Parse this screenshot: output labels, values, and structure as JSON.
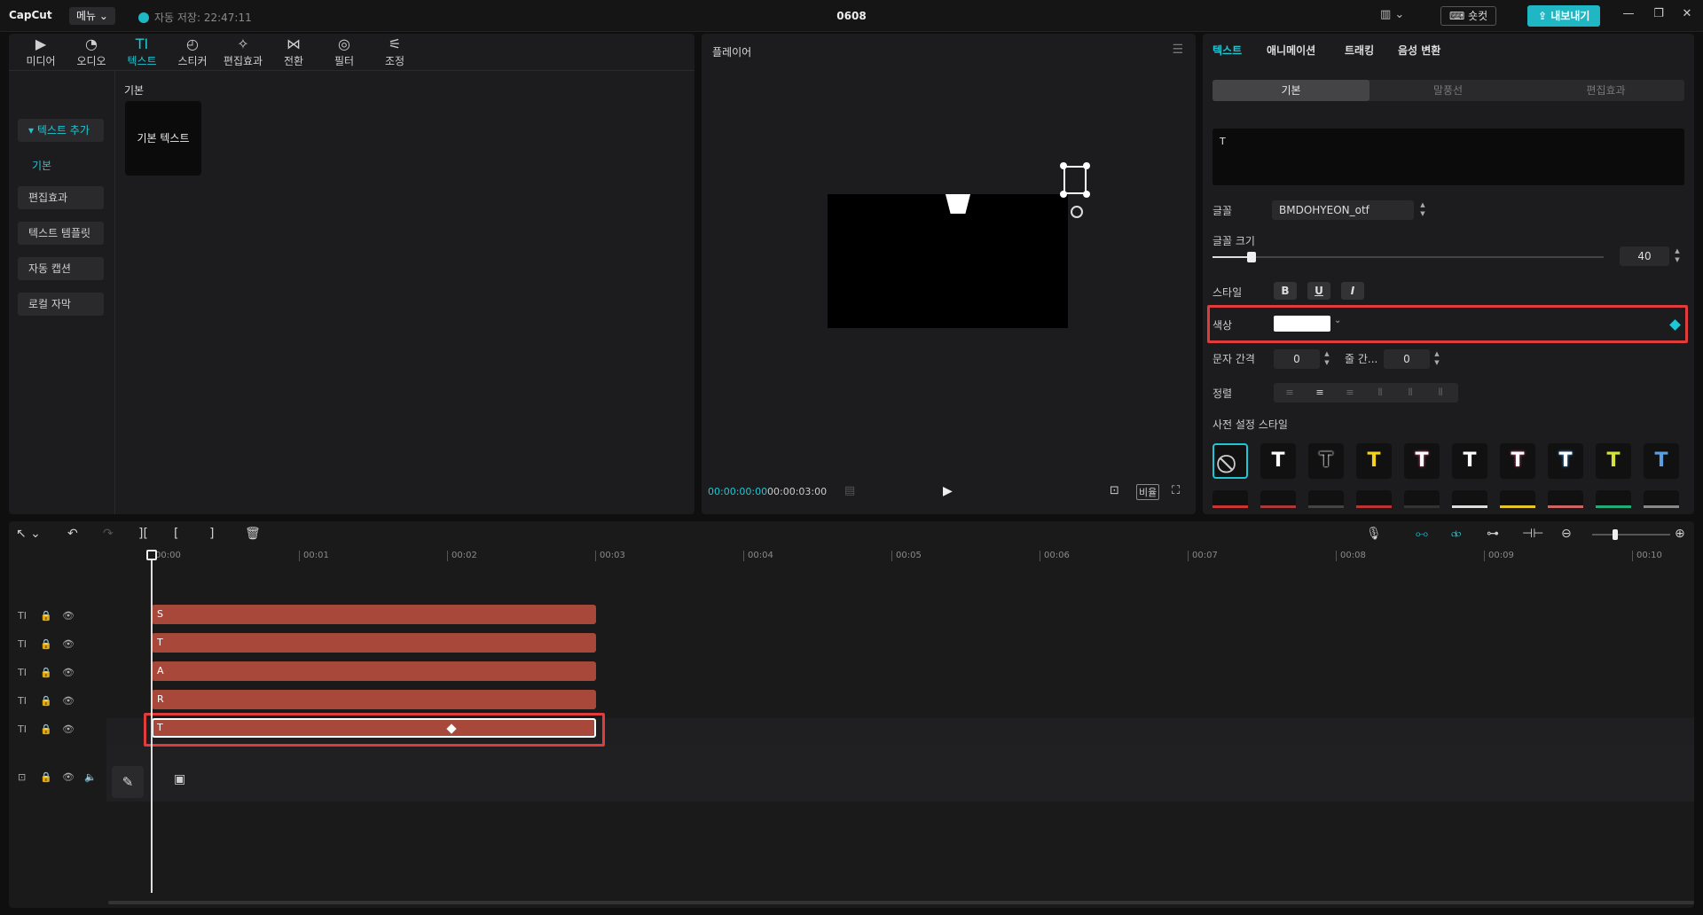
{
  "titlebar": {
    "logo": "CapCut",
    "menu_label": "메뉴 ⌄",
    "autosave": "자동 저장: 22:47:11",
    "title": "0608",
    "layout_icon": "▥ ⌄",
    "shortcut_label": "⌨ 숏컷",
    "export_label": "⇪ 내보내기",
    "minimize": "—",
    "maximize": "❐",
    "close": "✕"
  },
  "toolbar": {
    "tabs": [
      {
        "icon": "▶",
        "label": "미디어"
      },
      {
        "icon": "◔",
        "label": "오디오"
      },
      {
        "icon": "TI",
        "label": "텍스트"
      },
      {
        "icon": "◴",
        "label": "스티커"
      },
      {
        "icon": "✧",
        "label": "편집효과"
      },
      {
        "icon": "⋈",
        "label": "전환"
      },
      {
        "icon": "◎",
        "label": "필터"
      },
      {
        "icon": "⚟",
        "label": "조정"
      }
    ]
  },
  "left_nav": {
    "add_text": "▾ 텍스트 추가",
    "basic": "기본",
    "effects": "편집효과",
    "template": "텍스트 템플릿",
    "captions": "자동 캡션",
    "local_subtitle": "로컬 자막"
  },
  "library": {
    "section": "기본",
    "card_label": "기본 텍스트"
  },
  "player": {
    "title": "플레이어",
    "menu_icon": "☰",
    "time_current": "00:00:00:00",
    "time_total": "00:00:03:00",
    "timecode_icon": "▤",
    "play_icon": "▶",
    "zoom_fit_icon": "⊡",
    "ratio_label": "비율",
    "fullscreen_icon": "⛶"
  },
  "props": {
    "tabs": [
      "텍스트",
      "애니메이션",
      "트래킹",
      "음성 변환"
    ],
    "segments": [
      "기본",
      "말풍선",
      "편집효과"
    ],
    "text_value": "T",
    "font_label": "글꼴",
    "font_value": "BMDOHYEON_otf",
    "size_label": "글꼴 크기",
    "size_value": "40",
    "size_fraction": 0.1,
    "style_label": "스타일",
    "style_buttons": [
      "B",
      "U",
      "I"
    ],
    "color_label": "색상",
    "color_value": "#ffffff",
    "spacing_label": "문자 간격",
    "spacing_value": "0",
    "line_label": "줄 간...",
    "line_value": "0",
    "align_label": "정렬",
    "align_icons": [
      "≡",
      "≡",
      "≡",
      "⦀",
      "⦀",
      "⦀"
    ],
    "preset_label": "사전 설정 스타일",
    "presets": [
      {
        "glyph": "⃠",
        "color": "#cccccc"
      },
      {
        "glyph": "T",
        "color": "#ffffff"
      },
      {
        "glyph": "T",
        "color": "#111111"
      },
      {
        "glyph": "T",
        "color": "#f5d21b"
      },
      {
        "glyph": "T",
        "color": "#ffffff"
      },
      {
        "glyph": "T",
        "color": "#ffffff"
      },
      {
        "glyph": "T",
        "color": "#ffffff"
      },
      {
        "glyph": "T",
        "color": "#ffffff"
      },
      {
        "glyph": "T",
        "color": "#d4e23a"
      },
      {
        "glyph": "T",
        "color": "#5aa0e0"
      }
    ]
  },
  "timeline": {
    "tools": [
      "↖ ⌄",
      "↶",
      "↷",
      "][",
      "[",
      "]",
      "🗑"
    ],
    "right_tools": [
      "🎙",
      "⧟",
      "⧞",
      "⊶",
      "⊣⊢",
      "⊖",
      "⊕"
    ],
    "ticks": [
      "00:00",
      "00:01",
      "00:02",
      "00:03",
      "00:04",
      "00:05",
      "00:06",
      "00:07",
      "00:08",
      "00:09",
      "00:10"
    ],
    "track_icon": "TI",
    "lock_icon": "🔒",
    "eye_icon": "👁",
    "clips": [
      "S",
      "T",
      "A",
      "R",
      "T"
    ],
    "cover_icon": "✎",
    "film_icon": "▣",
    "zoom_fraction": 0.3
  }
}
